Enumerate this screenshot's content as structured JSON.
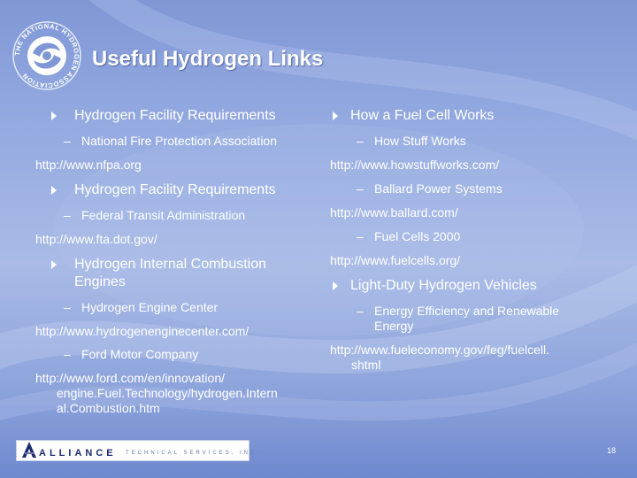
{
  "slide": {
    "title": "Useful Hydrogen Links",
    "page_number": "18"
  },
  "logo": {
    "ring_text": "THE NATIONAL HYDROGEN ASSOCIATION"
  },
  "left_column": {
    "item1_heading": "Hydrogen Facility Requirements",
    "item1_org": "National Fire Protection Association",
    "item1_url": "http://www.nfpa.org",
    "item2_heading": "Hydrogen Facility Requirements",
    "item2_org": "Federal Transit Administration",
    "item2_url": "http://www.fta.dot.gov/",
    "item3_heading_line1": "Hydrogen Internal Combustion",
    "item3_heading_line2": "Engines",
    "item3_org1": "Hydrogen Engine Center",
    "item3_url1": "http://www.hydrogenenginecenter.com/",
    "item3_org2": "Ford Motor Company",
    "item3_url2_line1": "http://www.ford.com/en/innovation/",
    "item3_url2_line2": "engine.Fuel.Technology/hydrogen.Intern",
    "item3_url2_line3": "al.Combustion.htm"
  },
  "right_column": {
    "item1_heading": "How a Fuel Cell Works",
    "item1_org1": "How Stuff Works",
    "item1_url1": "http://www.howstuffworks.com/",
    "item1_org2": "Ballard Power Systems",
    "item1_url2": "http://www.ballard.com/",
    "item1_org3": "Fuel Cells 2000",
    "item1_url3": "http://www.fuelcells.org/",
    "item2_heading": "Light-Duty Hydrogen Vehicles",
    "item2_org_line1": "Energy Efficiency and Renewable",
    "item2_org_line2": "Energy",
    "item2_url_line1": "http://www.fueleconomy.gov/feg/fuelcell.",
    "item2_url_line2": "shtml"
  },
  "footer": {
    "company_name": "ALLIANCE",
    "company_sub": "TECHNICAL SERVICES, INC."
  },
  "symbols": {
    "dash": "–"
  },
  "colors": {
    "background_top": "#7f97d6",
    "background_bottom": "#6f89cf",
    "text": "#ffffff",
    "company_brand": "#1c2a70"
  }
}
